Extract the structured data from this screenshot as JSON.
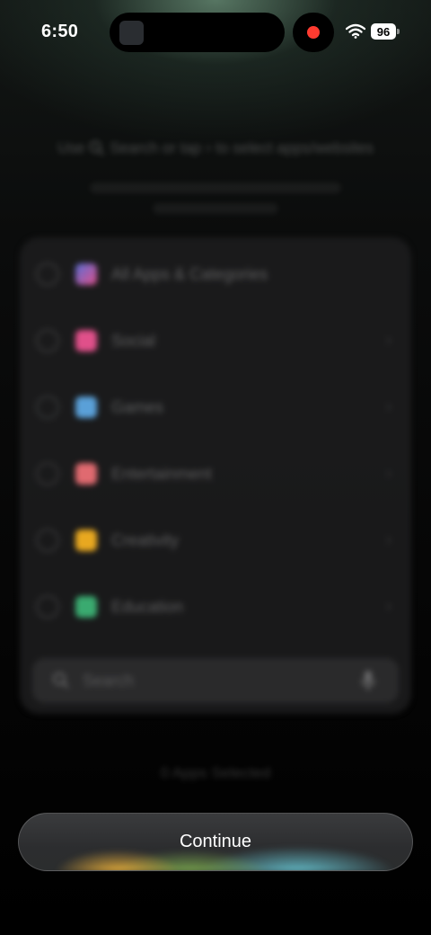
{
  "status_bar": {
    "time": "6:50",
    "battery": "96",
    "icons": [
      "wifi-icon",
      "record-indicator-icon"
    ]
  },
  "hint": {
    "prefix": "Use",
    "search_word": "Search or tap",
    "suffix": "to select apps/websites"
  },
  "categories": [
    {
      "label": "All Apps & Categories",
      "color": "#5a6fd6"
    },
    {
      "label": "Social",
      "color": "#e0508a"
    },
    {
      "label": "Games",
      "color": "#5aa0d8"
    },
    {
      "label": "Entertainment",
      "color": "#e06a70"
    },
    {
      "label": "Creativity",
      "color": "#e8a820"
    },
    {
      "label": "Education",
      "color": "#3aaa70"
    }
  ],
  "search": {
    "placeholder": "Search"
  },
  "footer": {
    "selected_count": "0 Apps Selected"
  },
  "continue_button": {
    "label": "Continue"
  },
  "colors": {
    "record_dot": "#ff3b30",
    "glow_yellow": "#ffbe3c",
    "glow_green": "#96d25a",
    "glow_cyan": "#6ed7e6"
  }
}
